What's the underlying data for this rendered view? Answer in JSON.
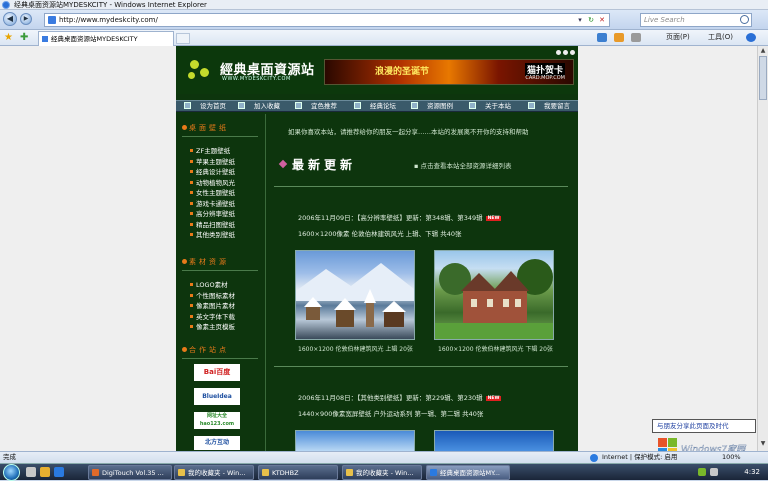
{
  "window": {
    "title": "经典桌面资源站MYDESKCITY - Windows Internet Explorer"
  },
  "browser": {
    "url": "http://www.mydeskcity.com/",
    "search_placeholder": "Live Search",
    "tab_title": "经典桌面资源站MYDESKCITY",
    "page_menu": "页面(P)",
    "tools_menu": "工具(O)"
  },
  "site": {
    "logo_text": "經典桌面資源站",
    "logo_url": "WWW.MYDESKCITY.COM",
    "ad_main": "浪漫的圣诞节",
    "ad_brand": "猫扑贺卡",
    "ad_url": "CARD.MOP.COM",
    "menu": [
      {
        "label": "设为首页"
      },
      {
        "label": "加入收藏"
      },
      {
        "label": "宜色推荐"
      },
      {
        "label": "经典论坛"
      },
      {
        "label": "资源图例"
      },
      {
        "label": "关于本站"
      },
      {
        "label": "我要留言"
      }
    ],
    "sidebar": {
      "wallpaper_title": "桌面壁纸",
      "wallpaper_items": [
        "ZF主题壁纸",
        "苹果主题壁纸",
        "经典设计壁纸",
        "动物植物风光",
        "女性主题壁纸",
        "游戏卡通壁纸",
        "高分辨率壁纸",
        "精品扫图壁纸",
        "其他类别壁纸"
      ],
      "material_title": "素材资源",
      "material_items": [
        "LOGO素材",
        "个性图标素材",
        "像素图片素材",
        "英文字体下载",
        "像素主页模板"
      ],
      "partner_title": "合作站点",
      "partners": [
        "Bai百度",
        "BlueIdea",
        "网址大全 hao123.com",
        "北方互动"
      ]
    },
    "main": {
      "intro": "如果你喜欢本站，请推荐给你的朋友一起分享……本站的发展离不开你的支持和帮助",
      "section_title": "最新更新",
      "all_link": "点击查看本站全部资源详细列表",
      "updates": [
        {
          "line1": "2006年11月09日：【高分辨率壁纸】更新：第348辑、第349辑",
          "line2": "1600×1200像素 伦敦伯林建筑风光 上辑、下辑 共40张",
          "captions": [
            "1600×1200 伦敦伯林建筑风光 上辑 20张",
            "1600×1200 伦敦伯林建筑风光 下辑 20张"
          ]
        },
        {
          "line1": "2006年11月08日：【其他类别壁纸】更新：第229辑、第230辑",
          "line2": "1440×900像素宽屏壁纸 户外运动系列 第一辑、第二辑 共40张"
        }
      ],
      "new_badge": "NEW"
    }
  },
  "statusbar": {
    "text": "完成",
    "zone": "Internet | 保护模式: 启用",
    "zoom": "100%"
  },
  "taskbar": {
    "tasks": [
      "DigiTouch Vol.35 ...",
      "我的收藏夹 - Win...",
      "KTDHBZ",
      "我的收藏夹 - Win...",
      "经典桌面资源站MY..."
    ],
    "clock": "4:32"
  },
  "balloon": {
    "text": "与朋友分享此页面及时代"
  },
  "watermark": {
    "text": "Windows7家园"
  },
  "colors": {
    "site_bg": "#0d350d",
    "accent": "#e87a1a",
    "menubar": "#3a5a6a"
  }
}
